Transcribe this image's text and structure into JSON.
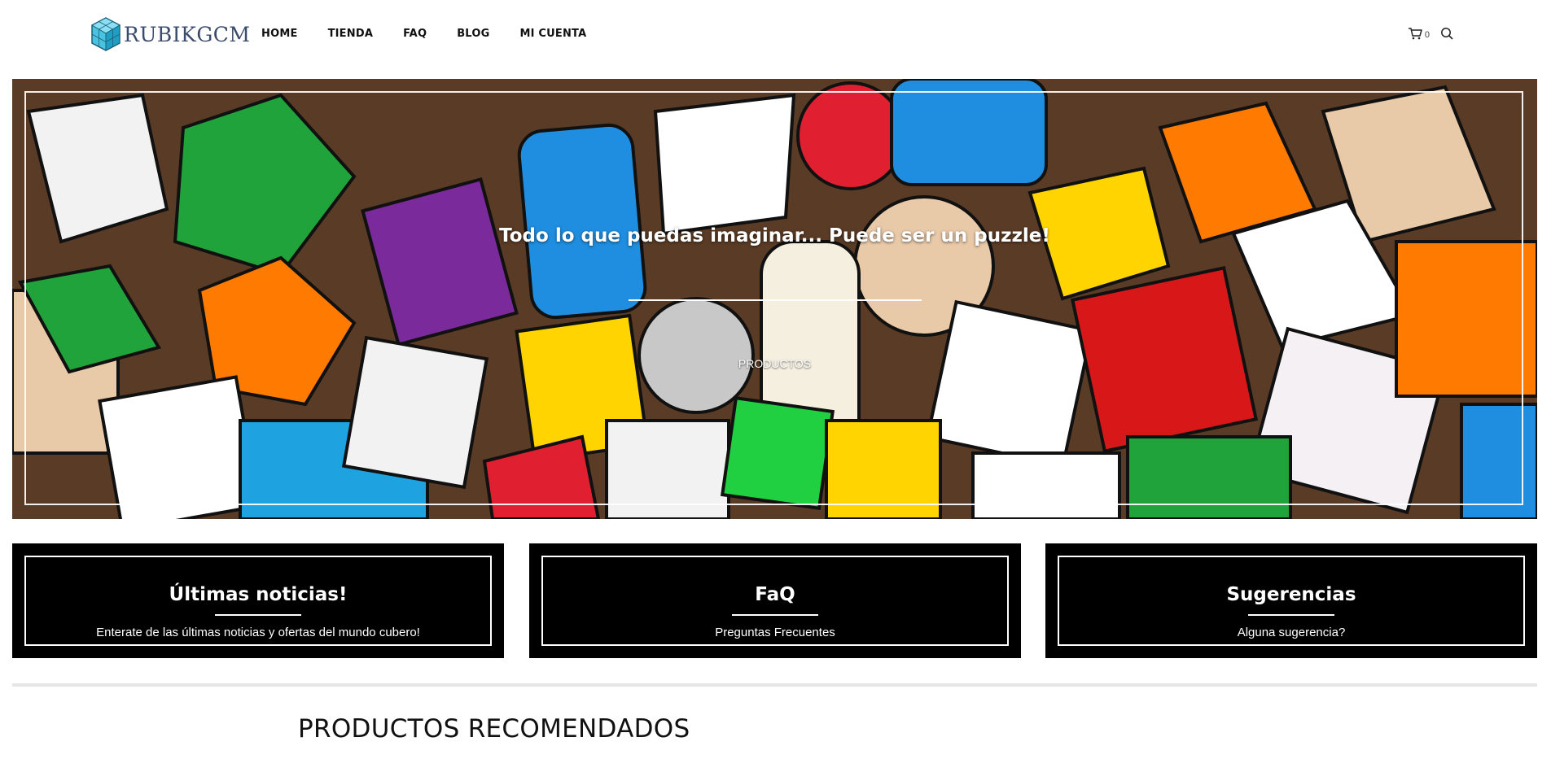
{
  "brand": {
    "name": "RUBIKGCM"
  },
  "nav": {
    "items": [
      {
        "label": "HOME"
      },
      {
        "label": "TIENDA"
      },
      {
        "label": "FAQ"
      },
      {
        "label": "BLOG"
      },
      {
        "label": "MI CUENTA"
      }
    ]
  },
  "header": {
    "cart_count": "0",
    "cart_icon": "shopping-cart-icon",
    "search_icon": "search-icon"
  },
  "hero": {
    "title": "Todo lo que puedas imaginar... Puede ser un puzzle!",
    "button_label": "PRODUCTOS"
  },
  "boxes": [
    {
      "title": "Últimas noticias!",
      "subtitle": "Enterate de las últimas noticias y ofertas del mundo cubero!"
    },
    {
      "title": "FaQ",
      "subtitle": "Preguntas Frecuentes"
    },
    {
      "title": "Sugerencias",
      "subtitle": "Alguna sugerencia?"
    }
  ],
  "section": {
    "title": "PRODUCTOS RECOMENDADOS"
  },
  "colors": {
    "box_bg": "#000000",
    "text": "#111111",
    "logo_text": "#3b4b6b",
    "logo_cube": "#2bb6d6"
  }
}
